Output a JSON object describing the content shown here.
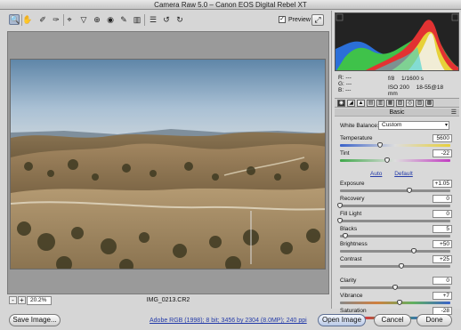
{
  "window": {
    "title": "Camera Raw 5.0  –  Canon EOS Digital Rebel XT"
  },
  "toolbar": {
    "tools": [
      {
        "name": "zoom-tool",
        "icon": "zoom-icon",
        "glyph": "🔍",
        "active": true
      },
      {
        "name": "hand-tool",
        "icon": "hand-icon",
        "glyph": "✋",
        "active": false
      },
      {
        "name": "white-balance-tool",
        "icon": "eyedropper-icon",
        "glyph": "✐",
        "active": false
      },
      {
        "name": "color-sampler-tool",
        "icon": "color-sampler-icon",
        "glyph": "✑",
        "active": false
      },
      {
        "name": "crop-tool",
        "icon": "crop-icon",
        "glyph": "⌖",
        "active": false
      },
      {
        "name": "straighten-tool",
        "icon": "straighten-icon",
        "glyph": "▽",
        "active": false
      },
      {
        "name": "retouch-tool",
        "icon": "spot-removal-icon",
        "glyph": "⊕",
        "active": false
      },
      {
        "name": "red-eye-tool",
        "icon": "red-eye-icon",
        "glyph": "◉",
        "active": false
      },
      {
        "name": "adjustment-brush-tool",
        "icon": "brush-icon",
        "glyph": "✎",
        "active": false
      },
      {
        "name": "graduated-filter-tool",
        "icon": "graduated-filter-icon",
        "glyph": "▥",
        "active": false
      },
      {
        "name": "preferences-tool",
        "icon": "list-icon",
        "glyph": "☰",
        "active": false
      },
      {
        "name": "rotate-left-tool",
        "icon": "rotate-left-icon",
        "glyph": "↺",
        "active": false
      },
      {
        "name": "rotate-right-tool",
        "icon": "rotate-right-icon",
        "glyph": "↻",
        "active": false
      }
    ],
    "preview_label": "Preview",
    "preview_checked": true,
    "fullscreen_icon": "fullscreen-icon"
  },
  "image": {
    "filename": "IMG_0213.CR2"
  },
  "zoom": {
    "level": "20.2%",
    "minus": "-",
    "plus": "+"
  },
  "info": {
    "r_label": "R:",
    "g_label": "G:",
    "b_label": "B:",
    "r_value": "---",
    "g_value": "---",
    "b_value": "---",
    "aperture": "f/8",
    "shutter": "1/1600 s",
    "iso": "ISO 200",
    "lens": "18-55@18 mm"
  },
  "panel": {
    "title": "Basic",
    "menu_icon": "panel-menu-icon"
  },
  "basic": {
    "white_balance_label": "White Balance:",
    "white_balance_value": "Custom",
    "auto_label": "Auto",
    "default_label": "Default",
    "sliders": [
      {
        "key": "temperature",
        "label": "Temperature",
        "value": "5600",
        "fraction": 0.36,
        "track": "temp"
      },
      {
        "key": "tint",
        "label": "Tint",
        "value": "-22",
        "fraction": 0.43,
        "track": "tint"
      },
      {
        "key": "exposure",
        "label": "Exposure",
        "value": "+1.05",
        "fraction": 0.63,
        "track": ""
      },
      {
        "key": "recovery",
        "label": "Recovery",
        "value": "0",
        "fraction": 0.0,
        "track": ""
      },
      {
        "key": "fill-light",
        "label": "Fill Light",
        "value": "0",
        "fraction": 0.0,
        "track": ""
      },
      {
        "key": "blacks",
        "label": "Blacks",
        "value": "5",
        "fraction": 0.05,
        "track": ""
      },
      {
        "key": "brightness",
        "label": "Brightness",
        "value": "+50",
        "fraction": 0.67,
        "track": ""
      },
      {
        "key": "contrast",
        "label": "Contrast",
        "value": "+25",
        "fraction": 0.56,
        "track": ""
      },
      {
        "key": "clarity",
        "label": "Clarity",
        "value": "0",
        "fraction": 0.5,
        "track": ""
      },
      {
        "key": "vibrance",
        "label": "Vibrance",
        "value": "+7",
        "fraction": 0.54,
        "track": "vib"
      },
      {
        "key": "saturation",
        "label": "Saturation",
        "value": "-28",
        "fraction": 0.36,
        "track": "sat"
      }
    ]
  },
  "bottom": {
    "save_label": "Save Image...",
    "workflow_label": "Adobe RGB (1998); 8 bit; 3456 by 2304 (8.0MP); 240 ppi",
    "open_label": "Open Image",
    "cancel_label": "Cancel",
    "done_label": "Done"
  },
  "colors": {
    "accent": "#a9b8cf",
    "link": "#233aa8",
    "histogram_bg": "#232323"
  }
}
